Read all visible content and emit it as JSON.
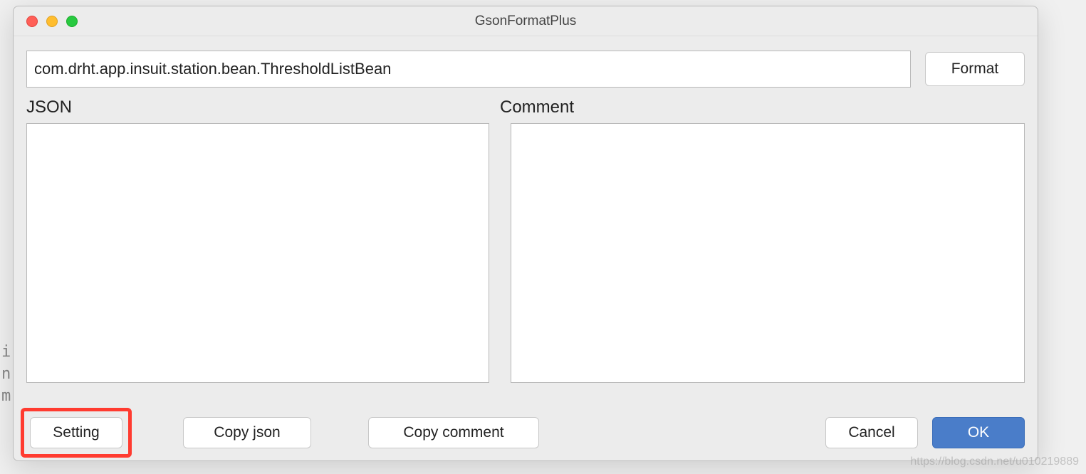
{
  "window": {
    "title": "GsonFormatPlus"
  },
  "top": {
    "class_name": "com.drht.app.insuit.station.bean.ThresholdListBean",
    "format_label": "Format"
  },
  "labels": {
    "json": "JSON",
    "comment": "Comment"
  },
  "textareas": {
    "json_value": "",
    "comment_value": ""
  },
  "buttons": {
    "setting": "Setting",
    "copy_json": "Copy  json",
    "copy_comment": "Copy comment",
    "cancel": "Cancel",
    "ok": "OK"
  },
  "bg": {
    "line1": "i",
    "line2": "n",
    "line3": "m"
  },
  "watermark": "https://blog.csdn.net/u010219889"
}
